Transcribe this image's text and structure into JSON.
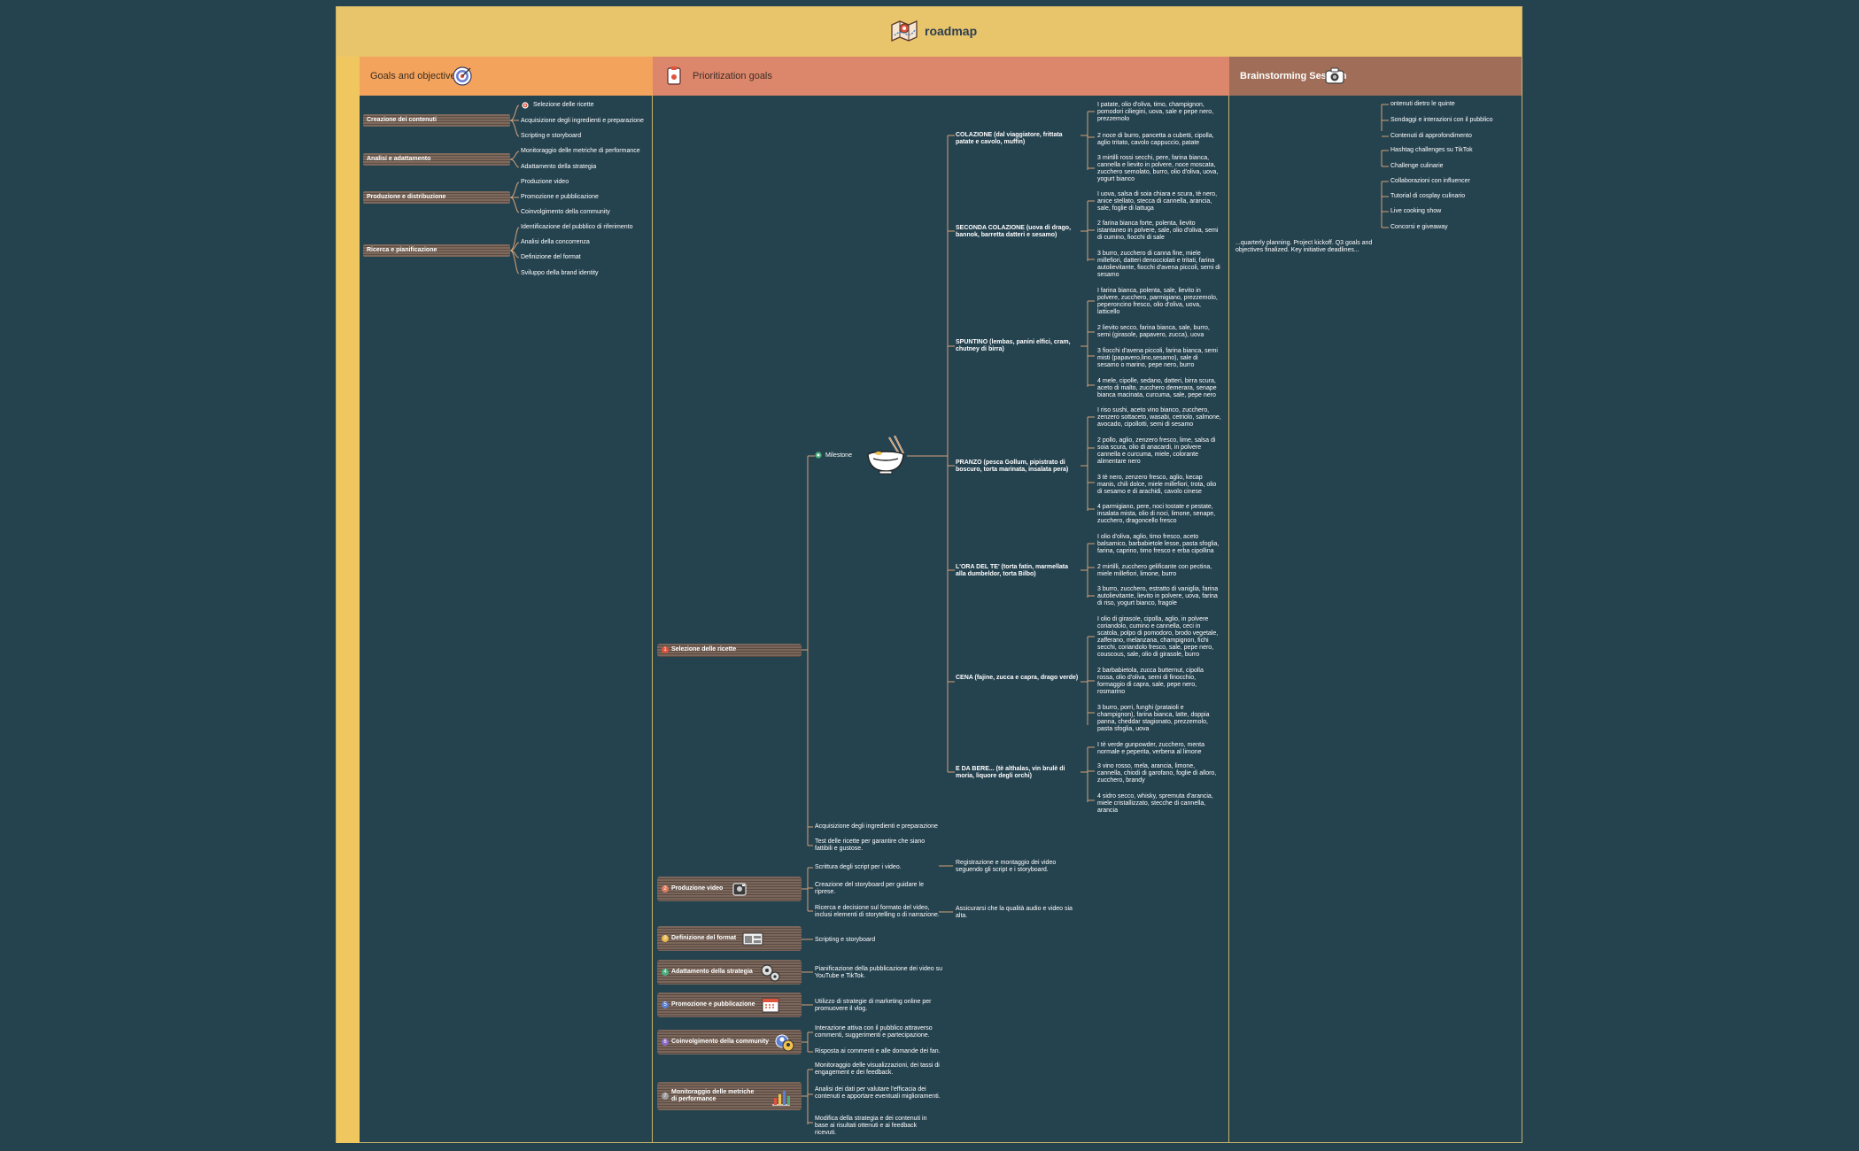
{
  "title": "roadmap",
  "columns": {
    "goals": "Goals and objectives",
    "prioritization": "Prioritization goals",
    "brainstorming": "Brainstorming Session"
  },
  "goals_map": {
    "branches": [
      {
        "label": "Creazione dei contenuti",
        "children": [
          "Selezione delle ricette",
          "Acquisizione degli ingredienti e preparazione",
          "Scripting e storyboard"
        ]
      },
      {
        "label": "Analisi e adattamento",
        "children": [
          "Monitoraggio delle metriche di performance",
          "Adattamento della strategia"
        ]
      },
      {
        "label": "Produzione e distribuzione",
        "children": [
          "Produzione video",
          "Promozione e pubblicazione",
          "Coinvolgimento della community"
        ]
      },
      {
        "label": "Ricerca e pianificazione",
        "children": [
          "Identificazione del pubblico di riferimento",
          "Analisi della concorrenza",
          "Definizione del format",
          "Sviluppo della brand identity"
        ]
      }
    ]
  },
  "priority_map": {
    "milestone_label": "Milestone",
    "selezione": {
      "label": "Selezione delle ricette",
      "meals": [
        {
          "label": "COLAZIONE (dal viaggiatore, frittata patate e cavolo, muffin)",
          "recipes": [
            "I patate, olio d'oliva, timo, champignon, pomodori ciliegini, uova, sale e pepe nero, prezzemolo",
            "2 noce di burro, pancetta a cubetti, cipolla, aglio tritato, cavolo cappuccio, patate",
            "3 mirtilli rossi secchi, pere, farina bianca, cannella e lievito in polvere, noce moscata, zucchero semolato, burro, olio d'oliva, uova, yogurt bianco"
          ]
        },
        {
          "label": "SECONDA COLAZIONE (uova di drago, bannok, barretta datteri e sesamo)",
          "recipes": [
            "I uova, salsa di soia chiara e scura, tè nero, anice stellato, stecca di cannella, arancia, sale, foglie di lattuga",
            "2 farina bianca forte, polenta, lievito istantaneo in polvere, sale, olio d'oliva, semi di cumino, fiocchi di sale",
            "3 burro, zucchero di canna fine, miele millefiori, datteri denocciolati e tritati, farina autolievitante, fiocchi d'avena piccoli, semi di sesamo"
          ]
        },
        {
          "label": "SPUNTINO (lembas, panini elfici, cram, chutney di birra)",
          "recipes": [
            "I farina bianca, polenta, sale, lievito in polvere, zucchero, parmigiano, prezzemolo, peperoncino fresco, olio d'oliva, uova, latticello",
            "2 lievito secco, farina bianca, sale, burro, semi (girasole, papavero, zucca), uova",
            "3 fiocchi d'avena piccoli, farina bianca, semi misti (papavero,lino,sesamo), sale di sesamo o marino, pepe nero, burro",
            "4 mele, cipolle, sedano, datteri, birra scura, aceto di malto, zucchero demerara, senape bianca macinata, curcuma, sale, pepe nero"
          ]
        },
        {
          "label": "PRANZO (pesca Gollum, pipistrato di boscuro, torta marinata, insalata pera)",
          "recipes": [
            "I riso sushi, aceto vino bianco, zucchero, zenzero sottaceto, wasabi, cetriolo, salmone, avocado, cipollotti, semi di sesamo",
            "2 pollo, aglio, zenzero fresco, lime, salsa di soia scura, olio di anacardi, in polvere cannella e curcuma, miele, colorante alimentare nero",
            "3 tè nero, zenzero fresco, aglio, kecap manis, chili dolce, miele millefiori, trota, olio di sesamo e di arachidi, cavolo cinese",
            "4 parmigiano, pere, noci tostate e pestate, insalata mista, olio di noci, limone, senape, zucchero, dragoncello fresco"
          ]
        },
        {
          "label": "L'ORA DEL TE' (torta fatin, marmellata alla dumbeldor, torta Bilbo)",
          "recipes": [
            "I olio d'oliva, aglio, timo fresco, aceto balsamico, barbabietole lesse, pasta sfoglia, farina, caprino, timo fresco e erba cipollina",
            "2 mirtilli, zucchero gelificante con pectina, miele millefiori, limone, burro",
            "3 burro, zucchero, estratto di vaniglia, farina autolievitante, lievito in polvere, uova, farina di riso, yogurt bianco, fragole"
          ]
        },
        {
          "label": "CENA (fajine, zucca e capra, drago verde)",
          "recipes": [
            "I olio di girasole, cipolla, aglio, in polvere coriandolo, cumino e cannella, ceci in scatola, polpo di pomodoro, brodo vegetale, zafferano, melanzana, champignon, fichi secchi, coriandolo fresco, sale, pepe nero, couscous, sale, olio di girasole, burro",
            "2 barbabietola, zucca butternut, cipolla rossa, olio d'oliva, semi di finocchio, formaggio di capra, sale, pepe nero, rosmarino",
            "3 burro, porri, funghi (prataioli e champignon), farina bianca, latte, doppia panna, cheddar stagionato, prezzemolo, pasta sfoglia, uova"
          ]
        },
        {
          "label": "E DA BERE... (tè althalas, vin brulè di moria, liquore degli orchi)",
          "recipes": [
            "I tè verde gunpowder, zucchero, menta normale e peperita, verbena al limone",
            "3 vino rosso, mela, arancia, limone, cannella, chiodi di garofano, foglie di alloro, zucchero, brandy",
            "4 sidro secco, whisky, spremuta d'arancia, miele cristallizzato, stecche di cannella, arancia"
          ]
        }
      ],
      "extra": [
        "Acquisizione degli ingredienti e preparazione",
        "Test delle ricette per garantire che siano fattibili e gustose."
      ]
    },
    "others": [
      {
        "num": "2",
        "label": "Produzione video",
        "color": "#e07a5f",
        "children": [
          "Scrittura degli script per i video.",
          "Creazione del storyboard per guidare le riprese.",
          "Ricerca e decisione sul formato del video, inclusi elementi di storytelling o di narrazione."
        ],
        "notes": [
          "Registrazione e montaggio dei video seguendo gli script e i storyboard.",
          "Assicurarsi che la qualità audio e video sia alta."
        ]
      },
      {
        "num": "3",
        "label": "Definizione del format",
        "color": "#e8b64c",
        "children": [
          "Scripting e storyboard"
        ]
      },
      {
        "num": "4",
        "label": "Adattamento della strategia",
        "color": "#4caf7d",
        "children": [
          "Pianificazione della pubblicazione dei video su YouTube e TikTok."
        ]
      },
      {
        "num": "5",
        "label": "Promozione e pubblicazione",
        "color": "#5b7fd1",
        "children": [
          "Utilizzo di strategie di marketing online per promuovere il vlog."
        ]
      },
      {
        "num": "6",
        "label": "Coinvolgimento della community",
        "color": "#8c6bc8",
        "children": [
          "Interazione attiva con il pubblico attraverso commenti, suggerimenti e partecipazione.",
          "Risposta ai commenti e alle domande dei fan."
        ]
      },
      {
        "num": "7",
        "label": "Monitoraggio delle metriche di performance",
        "color": "#9e9e9e",
        "children": [
          "Monitoraggio delle visualizzazioni, dei tassi di engagement e dei feedback.",
          "Analisi dei dati per valutare l'efficacia dei contenuti e apportare eventuali miglioramenti.",
          "Modifica della strategia e dei contenuti in base ai risultati ottenuti e ai feedback ricevuti."
        ]
      }
    ]
  },
  "brainstorm": {
    "items": [
      "ontenuti dietro le quinte",
      "Sondaggi e interazioni con il pubblico",
      "Contenuti di approfondimento",
      "Hashtag challenges su TikTok",
      "Challenge culinarie",
      "Collaborazioni con influencer",
      "Tutorial di cosplay culinario",
      "Live cooking show",
      "Concorsi e giveaway"
    ],
    "note": "...quarterly planning. Project kickoff. Q3 goals and objectives finalized. Key initiative deadlines..."
  },
  "colors": {
    "background": "#25424f",
    "title_bar": "#e8c46a",
    "goals_header": "#f4a35c",
    "prioritization_header": "#dc866c",
    "brainstorming_header": "#a06e58"
  }
}
